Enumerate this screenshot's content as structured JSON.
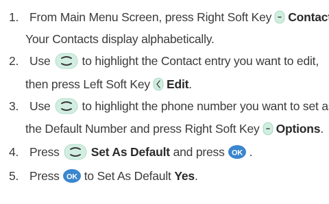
{
  "steps": [
    {
      "number": "1.",
      "line1_a": "From Main Menu Screen, press Right Soft Key",
      "line1_b": "Contacts",
      "line1_c": ".",
      "line2": "Your Contacts display alphabetically."
    },
    {
      "number": "2.",
      "line1_a": "Use",
      "line1_b": "to highlight the Contact entry you want to edit,",
      "line2_a": "then press Left Soft Key",
      "line2_b": "Edit",
      "line2_c": "."
    },
    {
      "number": "3.",
      "line1_a": "Use",
      "line1_b": "to highlight the phone number you want to set as",
      "line2_a": "the Default Number and press Right Soft Key",
      "line2_b": "Options",
      "line2_c": "."
    },
    {
      "number": "4.",
      "line1_a": "Press",
      "line1_b": "Set As Default",
      "line1_c": "and press",
      "line1_d": "."
    },
    {
      "number": "5.",
      "line1_a": "Press",
      "line1_b": "to Set As Default",
      "line1_c": "Yes",
      "line1_d": "."
    }
  ],
  "icons": {
    "right_soft_key": "right-soft-key-icon",
    "left_soft_key": "left-soft-key-icon",
    "nav_key": "navigation-key-icon",
    "ok_key": "ok-key-icon",
    "ok_label": "OK"
  },
  "colors": {
    "text": "#3b3b3b",
    "key_green": "#c9e7cf",
    "key_green_dark": "#8fc59a",
    "ok_blue": "#3a86cf"
  }
}
